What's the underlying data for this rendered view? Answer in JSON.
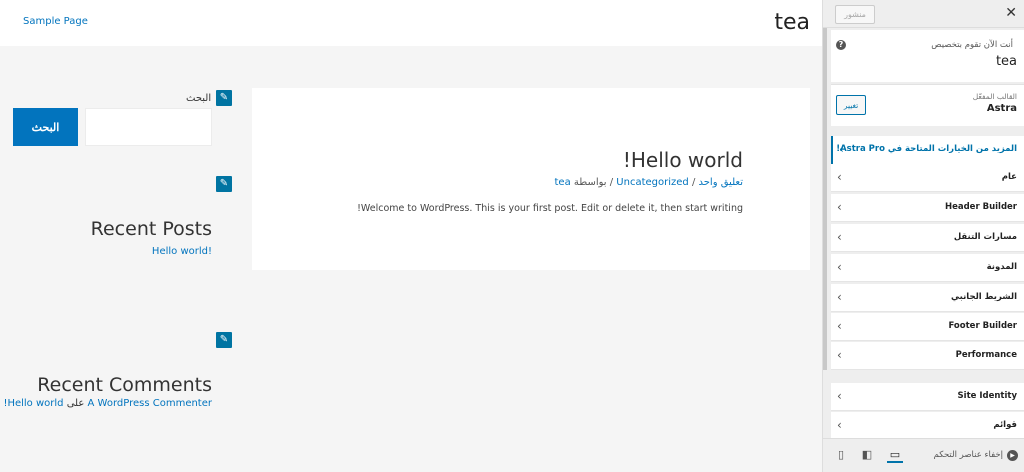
{
  "preview": {
    "site_title": "tea",
    "nav_link": "Sample Page",
    "post": {
      "title": "Hello world!",
      "meta_author_prefix": "بواسطة",
      "meta_author": "tea",
      "meta_sep": " / ",
      "meta_category": "Uncategorized",
      "meta_comments": "تعليق واحد",
      "excerpt": "Welcome to WordPress. This is your first post. Edit or delete it, then start writing!"
    },
    "search": {
      "label": "البحث",
      "placeholder": "",
      "button_label": "البحث"
    },
    "recent_posts": {
      "title": "Recent Posts",
      "items": [
        "Hello world!"
      ]
    },
    "recent_comments": {
      "title": "Recent Comments",
      "author": "A WordPress Commenter",
      "on": "على",
      "post": "Hello world!"
    },
    "edit_icon": "pencil-icon"
  },
  "customizer": {
    "close_icon": "close-icon",
    "publish_label": "منشور",
    "info_caption": "أنت الآن تقوم بتخصيص",
    "info_site": "tea",
    "help_icon": "help-icon",
    "theme_caption": "القالب المفعّل",
    "theme_name": "Astra",
    "theme_change_label": "تغيير",
    "pro_item": "المزيد من الخيارات المتاحة في Astra Pro!",
    "sections": [
      "عام",
      "Header Builder",
      "مسارات التنقل",
      "المدونة",
      "الشريط الجانبي",
      "Footer Builder",
      "Performance"
    ],
    "sections_2": [
      "Site Identity",
      "قوائم"
    ],
    "hide_controls_label": "إخفاء عناصر التحكم",
    "devices": [
      "desktop-icon",
      "tablet-icon",
      "mobile-icon"
    ]
  },
  "colors": {
    "accent": "#0274be",
    "customizer_accent": "#0073aa"
  }
}
